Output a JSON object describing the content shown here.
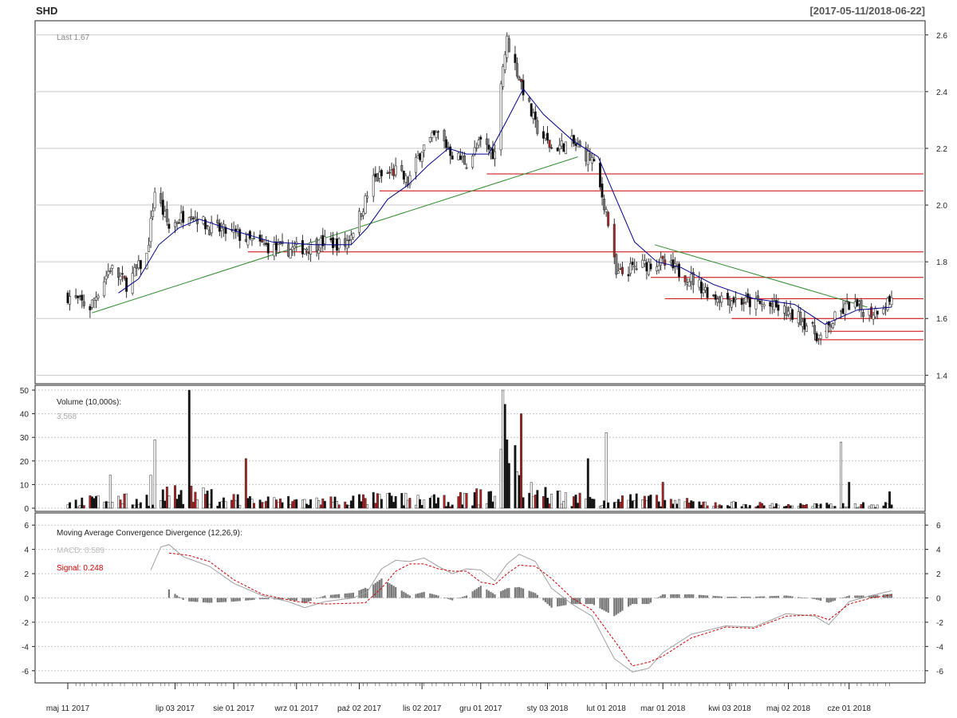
{
  "header": {
    "ticker": "SHD",
    "date_range": "[2017-05-11/2018-06-22]"
  },
  "colors": {
    "up_candle": "#ffffff",
    "down_candle": "#000000",
    "gray_candle": "#808080",
    "red_candle": "#b22222",
    "sma": "#00008b",
    "green_trend": "#2e8b2e",
    "red_level": "#cc0000",
    "grid": "#c8c8c8",
    "macd_line": "#a0a0a0",
    "signal_line": "#cc0000"
  },
  "chart_data": [
    {
      "type": "candlestick",
      "panel": "price",
      "label": "Last 1.67",
      "ylim": [
        1.37,
        2.65
      ],
      "yticks": [
        "1.4",
        "1.6",
        "1.8",
        "2.0",
        "2.2",
        "2.4",
        "2.6"
      ],
      "x_labels": [
        "maj 11 2017",
        "lip 03 2017",
        "sie 01 2017",
        "wrz 01 2017",
        "paź 02 2017",
        "lis 02 2017",
        "gru 01 2017",
        "sty 03 2018",
        "lut 01 2018",
        "mar 01 2018",
        "kwi 03 2018",
        "maj 02 2018",
        "cze 01 2018"
      ],
      "close_path": [
        [
          "2017-05-11",
          1.68
        ],
        [
          "2017-05-22",
          1.64
        ],
        [
          "2017-06-01",
          1.78
        ],
        [
          "2017-06-09",
          1.72
        ],
        [
          "2017-06-19",
          1.82
        ],
        [
          "2017-06-23",
          2.05
        ],
        [
          "2017-06-30",
          1.92
        ],
        [
          "2017-07-10",
          1.98
        ],
        [
          "2017-07-20",
          1.92
        ],
        [
          "2017-08-01",
          1.9
        ],
        [
          "2017-08-10",
          1.87
        ],
        [
          "2017-08-24",
          1.84
        ],
        [
          "2017-09-05",
          1.85
        ],
        [
          "2017-09-15",
          1.87
        ],
        [
          "2017-09-25",
          1.86
        ],
        [
          "2017-10-02",
          1.96
        ],
        [
          "2017-10-09",
          2.09
        ],
        [
          "2017-10-20",
          2.12
        ],
        [
          "2017-10-26",
          2.08
        ],
        [
          "2017-11-02",
          2.2
        ],
        [
          "2017-11-10",
          2.25
        ],
        [
          "2017-11-17",
          2.18
        ],
        [
          "2017-11-24",
          2.15
        ],
        [
          "2017-12-01",
          2.22
        ],
        [
          "2017-12-08",
          2.18
        ],
        [
          "2017-12-11",
          2.45
        ],
        [
          "2017-12-14",
          2.58
        ],
        [
          "2017-12-20",
          2.45
        ],
        [
          "2017-12-28",
          2.28
        ],
        [
          "2018-01-05",
          2.2
        ],
        [
          "2018-01-15",
          2.22
        ],
        [
          "2018-01-25",
          2.16
        ],
        [
          "2018-02-01",
          1.98
        ],
        [
          "2018-02-06",
          1.75
        ],
        [
          "2018-02-15",
          1.78
        ],
        [
          "2018-02-26",
          1.8
        ],
        [
          "2018-03-05",
          1.78
        ],
        [
          "2018-03-15",
          1.74
        ],
        [
          "2018-03-26",
          1.68
        ],
        [
          "2018-04-10",
          1.66
        ],
        [
          "2018-04-25",
          1.64
        ],
        [
          "2018-05-08",
          1.6
        ],
        [
          "2018-05-18",
          1.53
        ],
        [
          "2018-05-25",
          1.6
        ],
        [
          "2018-06-01",
          1.65
        ],
        [
          "2018-06-12",
          1.62
        ],
        [
          "2018-06-22",
          1.67
        ]
      ],
      "sma_path": [
        [
          "2017-06-05",
          1.69
        ],
        [
          "2017-06-15",
          1.74
        ],
        [
          "2017-06-25",
          1.86
        ],
        [
          "2017-07-05",
          1.92
        ],
        [
          "2017-07-15",
          1.95
        ],
        [
          "2017-08-01",
          1.91
        ],
        [
          "2017-08-20",
          1.87
        ],
        [
          "2017-09-10",
          1.86
        ],
        [
          "2017-09-28",
          1.86
        ],
        [
          "2017-10-06",
          1.92
        ],
        [
          "2017-10-16",
          2.02
        ],
        [
          "2017-10-26",
          2.07
        ],
        [
          "2017-11-05",
          2.14
        ],
        [
          "2017-11-15",
          2.2
        ],
        [
          "2017-11-24",
          2.18
        ],
        [
          "2017-12-05",
          2.18
        ],
        [
          "2017-12-14",
          2.3
        ],
        [
          "2017-12-22",
          2.41
        ],
        [
          "2018-01-01",
          2.32
        ],
        [
          "2018-01-15",
          2.23
        ],
        [
          "2018-01-28",
          2.17
        ],
        [
          "2018-02-06",
          2.02
        ],
        [
          "2018-02-15",
          1.87
        ],
        [
          "2018-02-26",
          1.8
        ],
        [
          "2018-03-10",
          1.78
        ],
        [
          "2018-03-26",
          1.72
        ],
        [
          "2018-04-15",
          1.67
        ],
        [
          "2018-05-05",
          1.65
        ],
        [
          "2018-05-20",
          1.58
        ],
        [
          "2018-06-05",
          1.63
        ],
        [
          "2018-06-22",
          1.64
        ]
      ],
      "trend_lines": [
        {
          "color": "green",
          "from": [
            "2017-05-23",
            1.62
          ],
          "to": [
            "2018-01-18",
            2.17
          ]
        },
        {
          "color": "green",
          "from": [
            "2018-02-25",
            1.86
          ],
          "to": [
            "2018-06-10",
            1.64
          ]
        }
      ],
      "horizontal_levels": [
        {
          "y": 2.11,
          "from": "2017-12-04",
          "to": "2018-06-22"
        },
        {
          "y": 2.05,
          "from": "2017-10-12",
          "to": "2018-06-22"
        },
        {
          "y": 1.835,
          "from": "2017-08-08",
          "to": "2018-06-22"
        },
        {
          "y": 1.745,
          "from": "2018-02-23",
          "to": "2018-06-22"
        },
        {
          "y": 1.67,
          "from": "2018-03-02",
          "to": "2018-06-22"
        },
        {
          "y": 1.6,
          "from": "2018-04-04",
          "to": "2018-06-22"
        },
        {
          "y": 1.555,
          "from": "2018-05-20",
          "to": "2018-06-22"
        },
        {
          "y": 1.525,
          "from": "2018-05-15",
          "to": "2018-06-22"
        }
      ]
    },
    {
      "type": "bar",
      "panel": "volume",
      "title": "Volume (10,000s):",
      "last_value": "3,568",
      "ylim": [
        0,
        50
      ],
      "yticks": [
        "0",
        "10",
        "20",
        "30",
        "40",
        "50"
      ],
      "profile": [
        [
          "2017-05-11",
          2
        ],
        [
          "2017-06-01",
          4
        ],
        [
          "2017-06-15",
          3
        ],
        [
          "2017-07-01",
          6
        ],
        [
          "2017-08-15",
          3
        ],
        [
          "2017-09-15",
          3
        ],
        [
          "2017-10-15",
          4
        ],
        [
          "2017-11-15",
          3
        ],
        [
          "2017-12-08",
          6
        ],
        [
          "2017-12-15",
          18
        ],
        [
          "2017-12-28",
          6
        ],
        [
          "2018-01-15",
          4
        ],
        [
          "2018-02-08",
          4
        ],
        [
          "2018-03-01",
          3
        ],
        [
          "2018-03-20",
          2
        ],
        [
          "2018-04-15",
          1.5
        ],
        [
          "2018-05-15",
          1.2
        ],
        [
          "2018-06-22",
          1.5
        ]
      ],
      "spikes": [
        {
          "date": "2017-06-23",
          "value": 29,
          "color": "white"
        },
        {
          "date": "2017-06-21",
          "value": 14,
          "color": "white"
        },
        {
          "date": "2017-07-10",
          "value": 50,
          "color": "black"
        },
        {
          "date": "2017-06-29",
          "value": 9,
          "color": "red"
        },
        {
          "date": "2017-06-01",
          "value": 14,
          "color": "white"
        },
        {
          "date": "2017-08-07",
          "value": 21,
          "color": "red"
        },
        {
          "date": "2017-12-11",
          "value": 25,
          "color": "white"
        },
        {
          "date": "2017-12-12",
          "value": 50,
          "color": "white"
        },
        {
          "date": "2017-12-13",
          "value": 44,
          "color": "black"
        },
        {
          "date": "2017-12-14",
          "value": 29,
          "color": "black"
        },
        {
          "date": "2017-12-15",
          "value": 19,
          "color": "black"
        },
        {
          "date": "2017-12-21",
          "value": 40,
          "color": "red"
        },
        {
          "date": "2018-01-23",
          "value": 21,
          "color": "black"
        },
        {
          "date": "2018-02-01",
          "value": 32,
          "color": "white"
        },
        {
          "date": "2018-03-01",
          "value": 11,
          "color": "red"
        },
        {
          "date": "2018-05-28",
          "value": 28,
          "color": "white"
        },
        {
          "date": "2018-06-01",
          "value": 11,
          "color": "black"
        },
        {
          "date": "2018-06-21",
          "value": 7,
          "color": "black"
        }
      ]
    },
    {
      "type": "line",
      "panel": "macd",
      "title": "Moving Average Convergence Divergence (12,26,9):",
      "macd_label": "MACD: 0.589",
      "signal_label": "Signal: 0.248",
      "ylim": [
        -7,
        7
      ],
      "yticks": [
        "-6",
        "-4",
        "-2",
        "0",
        "2",
        "4",
        "6"
      ],
      "series": [
        {
          "name": "MACD",
          "points": [
            [
              "2017-06-21",
              2.3
            ],
            [
              "2017-06-26",
              4.2
            ],
            [
              "2017-06-30",
              4.4
            ],
            [
              "2017-07-07",
              3.4
            ],
            [
              "2017-07-20",
              2.6
            ],
            [
              "2017-08-01",
              1.2
            ],
            [
              "2017-08-15",
              0.2
            ],
            [
              "2017-08-28",
              -0.3
            ],
            [
              "2017-09-05",
              -0.8
            ],
            [
              "2017-09-15",
              -0.3
            ],
            [
              "2017-09-29",
              0.0
            ],
            [
              "2017-10-06",
              0.5
            ],
            [
              "2017-10-13",
              2.4
            ],
            [
              "2017-10-20",
              3.1
            ],
            [
              "2017-10-27",
              3.0
            ],
            [
              "2017-11-03",
              3.3
            ],
            [
              "2017-11-10",
              2.6
            ],
            [
              "2017-11-17",
              2.0
            ],
            [
              "2017-11-24",
              2.4
            ],
            [
              "2017-12-01",
              2.3
            ],
            [
              "2017-12-08",
              1.4
            ],
            [
              "2017-12-14",
              2.8
            ],
            [
              "2017-12-20",
              3.6
            ],
            [
              "2017-12-28",
              3.0
            ],
            [
              "2018-01-05",
              0.8
            ],
            [
              "2018-01-15",
              -0.5
            ],
            [
              "2018-01-25",
              -1.5
            ],
            [
              "2018-02-05",
              -5.0
            ],
            [
              "2018-02-14",
              -6.1
            ],
            [
              "2018-02-22",
              -5.8
            ],
            [
              "2018-03-01",
              -4.5
            ],
            [
              "2018-03-15",
              -3.0
            ],
            [
              "2018-04-01",
              -2.3
            ],
            [
              "2018-04-15",
              -2.4
            ],
            [
              "2018-05-01",
              -1.3
            ],
            [
              "2018-05-15",
              -1.5
            ],
            [
              "2018-05-22",
              -2.2
            ],
            [
              "2018-06-01",
              -0.3
            ],
            [
              "2018-06-12",
              0.2
            ],
            [
              "2018-06-22",
              0.589
            ]
          ]
        },
        {
          "name": "Signal",
          "points": [
            [
              "2017-06-30",
              3.7
            ],
            [
              "2017-07-10",
              3.5
            ],
            [
              "2017-07-20",
              3.0
            ],
            [
              "2017-08-01",
              1.5
            ],
            [
              "2017-08-15",
              0.3
            ],
            [
              "2017-09-01",
              -0.3
            ],
            [
              "2017-09-15",
              -0.5
            ],
            [
              "2017-10-05",
              -0.4
            ],
            [
              "2017-10-13",
              0.8
            ],
            [
              "2017-10-20",
              2.2
            ],
            [
              "2017-10-27",
              2.8
            ],
            [
              "2017-11-03",
              2.8
            ],
            [
              "2017-11-10",
              2.4
            ],
            [
              "2017-11-17",
              2.2
            ],
            [
              "2017-11-24",
              2.2
            ],
            [
              "2017-12-01",
              1.3
            ],
            [
              "2017-12-08",
              1.1
            ],
            [
              "2017-12-14",
              2.0
            ],
            [
              "2017-12-20",
              2.7
            ],
            [
              "2017-12-28",
              2.6
            ],
            [
              "2018-01-05",
              1.6
            ],
            [
              "2018-01-15",
              0.0
            ],
            [
              "2018-01-25",
              -1.0
            ],
            [
              "2018-02-05",
              -3.5
            ],
            [
              "2018-02-14",
              -5.6
            ],
            [
              "2018-02-22",
              -5.3
            ],
            [
              "2018-03-01",
              -4.8
            ],
            [
              "2018-03-15",
              -3.3
            ],
            [
              "2018-04-01",
              -2.4
            ],
            [
              "2018-04-15",
              -2.5
            ],
            [
              "2018-05-01",
              -1.5
            ],
            [
              "2018-05-15",
              -1.4
            ],
            [
              "2018-05-22",
              -1.8
            ],
            [
              "2018-06-01",
              -0.5
            ],
            [
              "2018-06-12",
              0.0
            ],
            [
              "2018-06-22",
              0.248
            ]
          ]
        }
      ],
      "histogram": "macd_minus_signal"
    }
  ]
}
